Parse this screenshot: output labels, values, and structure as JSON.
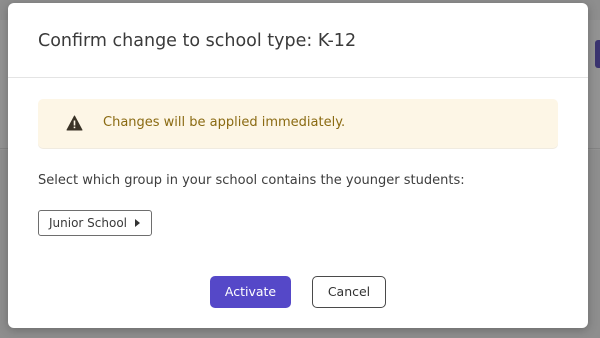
{
  "modal": {
    "title": "Confirm change to school type: K-12",
    "alert": {
      "icon": "warning-icon",
      "text": "Changes will be applied immediately.",
      "color": "#8a6a12",
      "background": "#fdf6e6"
    },
    "instruction": "Select which group in your school contains the younger students:",
    "group_select": {
      "selected": "Junior School",
      "icon": "caret-right-icon"
    },
    "buttons": {
      "activate_label": "Activate",
      "cancel_label": "Cancel"
    },
    "accent_color": "#5548c8"
  }
}
